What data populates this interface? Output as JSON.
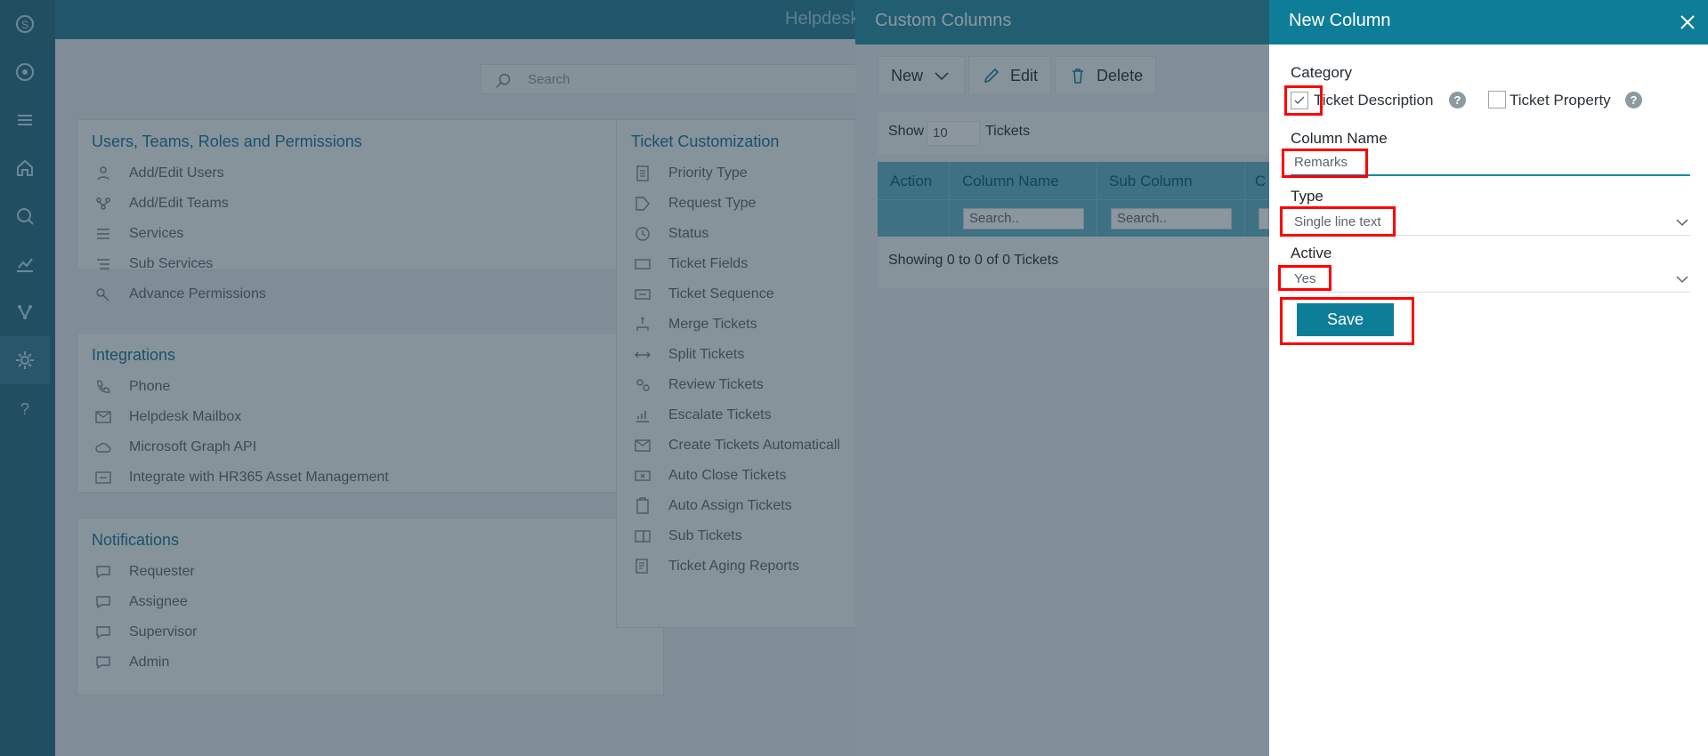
{
  "app": {
    "title": "Helpdesk",
    "rail": {
      "items": [
        {
          "name": "logo-icon"
        },
        {
          "name": "dashboard-icon"
        },
        {
          "name": "menu-icon"
        },
        {
          "name": "home-icon"
        },
        {
          "name": "search-ticket-icon"
        },
        {
          "name": "analytics-icon"
        },
        {
          "name": "network-icon"
        },
        {
          "name": "settings-icon"
        },
        {
          "name": "help-icon"
        }
      ]
    },
    "search": {
      "placeholder": "Search"
    },
    "sections": {
      "users": {
        "title": "Users, Teams, Roles and Permissions",
        "items": [
          {
            "label": "Add/Edit Users",
            "icon": "user-icon"
          },
          {
            "label": "Add/Edit Teams",
            "icon": "team-icon"
          },
          {
            "label": "Services",
            "icon": "list-icon"
          },
          {
            "label": "Sub Services",
            "icon": "sublist-icon"
          },
          {
            "label": "Advance Permissions",
            "icon": "key-icon"
          }
        ]
      },
      "integrations": {
        "title": "Integrations",
        "items": [
          {
            "label": "Phone",
            "icon": "phone-icon"
          },
          {
            "label": "Helpdesk Mailbox",
            "icon": "mail-icon"
          },
          {
            "label": "Microsoft Graph API",
            "icon": "cloud-icon"
          },
          {
            "label": "Integrate with HR365 Asset Management",
            "icon": "asset-icon"
          }
        ]
      },
      "notifications": {
        "title": "Notifications",
        "items": [
          {
            "label": "Requester",
            "icon": "message-icon"
          },
          {
            "label": "Assignee",
            "icon": "message-icon"
          },
          {
            "label": "Supervisor",
            "icon": "message-icon"
          },
          {
            "label": "Admin",
            "icon": "message-icon"
          }
        ]
      },
      "ticket": {
        "title": "Ticket Customization",
        "items": [
          {
            "label": "Priority Type",
            "icon": "document-icon"
          },
          {
            "label": "Request Type",
            "icon": "tag-icon"
          },
          {
            "label": "Status",
            "icon": "clock-icon"
          },
          {
            "label": "Ticket Fields",
            "icon": "fields-icon"
          },
          {
            "label": "Ticket Sequence",
            "icon": "sequence-icon"
          },
          {
            "label": "Merge Tickets",
            "icon": "merge-icon"
          },
          {
            "label": "Split Tickets",
            "icon": "split-icon"
          },
          {
            "label": "Review Tickets",
            "icon": "review-icon"
          },
          {
            "label": "Escalate Tickets",
            "icon": "escalate-icon"
          },
          {
            "label": "Create Tickets Automaticall",
            "icon": "auto-create-icon"
          },
          {
            "label": "Auto Close Tickets",
            "icon": "auto-close-icon"
          },
          {
            "label": "Auto Assign Tickets",
            "icon": "auto-assign-icon"
          },
          {
            "label": "Sub Tickets",
            "icon": "sub-tickets-icon"
          },
          {
            "label": "Ticket Aging Reports",
            "icon": "report-icon"
          }
        ]
      }
    }
  },
  "custom_columns": {
    "title": "Custom Columns",
    "toolbar": {
      "new_label": "New",
      "edit_label": "Edit",
      "delete_label": "Delete"
    },
    "show_label": "Show",
    "page_size": "10",
    "tickets_label": "Tickets",
    "columns": [
      "Action",
      "Column Name",
      "Sub Column",
      "C"
    ],
    "search_placeholder": "Search..",
    "footer": "Showing 0 to 0 of 0 Tickets"
  },
  "new_column": {
    "title": "New Column",
    "category_label": "Category",
    "options": [
      {
        "label": "Ticket Description",
        "checked": true
      },
      {
        "label": "Ticket Property",
        "checked": false
      }
    ],
    "help_glyph": "?",
    "column_name_label": "Column Name",
    "column_name_value": "Remarks",
    "type_label": "Type",
    "type_value": "Single line text",
    "active_label": "Active",
    "active_value": "Yes",
    "save_label": "Save"
  },
  "colors": {
    "accent": "#0e7d98",
    "highlight": "#ff0000"
  }
}
